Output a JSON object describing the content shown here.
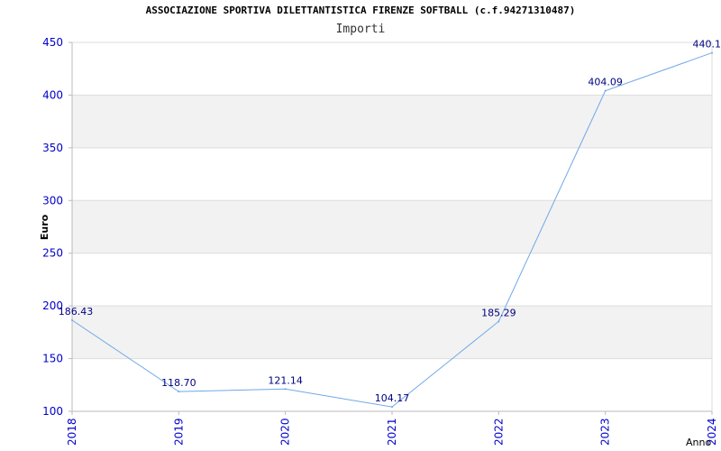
{
  "title": "ASSOCIAZIONE SPORTIVA DILETTANTISTICA FIRENZE SOFTBALL (c.f.94271310487)",
  "subtitle": "Importi",
  "chart_data": {
    "type": "line",
    "title": "ASSOCIAZIONE SPORTIVA DILETTANTISTICA FIRENZE SOFTBALL (c.f.94271310487)",
    "subtitle": "Importi",
    "xlabel": "Anno",
    "ylabel": "Euro",
    "categories": [
      "2018",
      "2019",
      "2020",
      "2021",
      "2022",
      "2023",
      "2024"
    ],
    "values": [
      186.43,
      118.7,
      121.14,
      104.17,
      185.29,
      404.09,
      440.1
    ],
    "data_labels": [
      "186.43",
      "118.70",
      "121.14",
      "104.17",
      "185.29",
      "404.09",
      "440.1"
    ],
    "yticks": [
      100,
      150,
      200,
      250,
      300,
      350,
      400,
      450
    ],
    "ylim": [
      100,
      450
    ],
    "grid": true,
    "colors": {
      "line": "#6fa8e8",
      "band": "#f2f2f2",
      "grid": "#dddddd",
      "tick_label": "#0000cc",
      "data_label": "#000080"
    }
  }
}
